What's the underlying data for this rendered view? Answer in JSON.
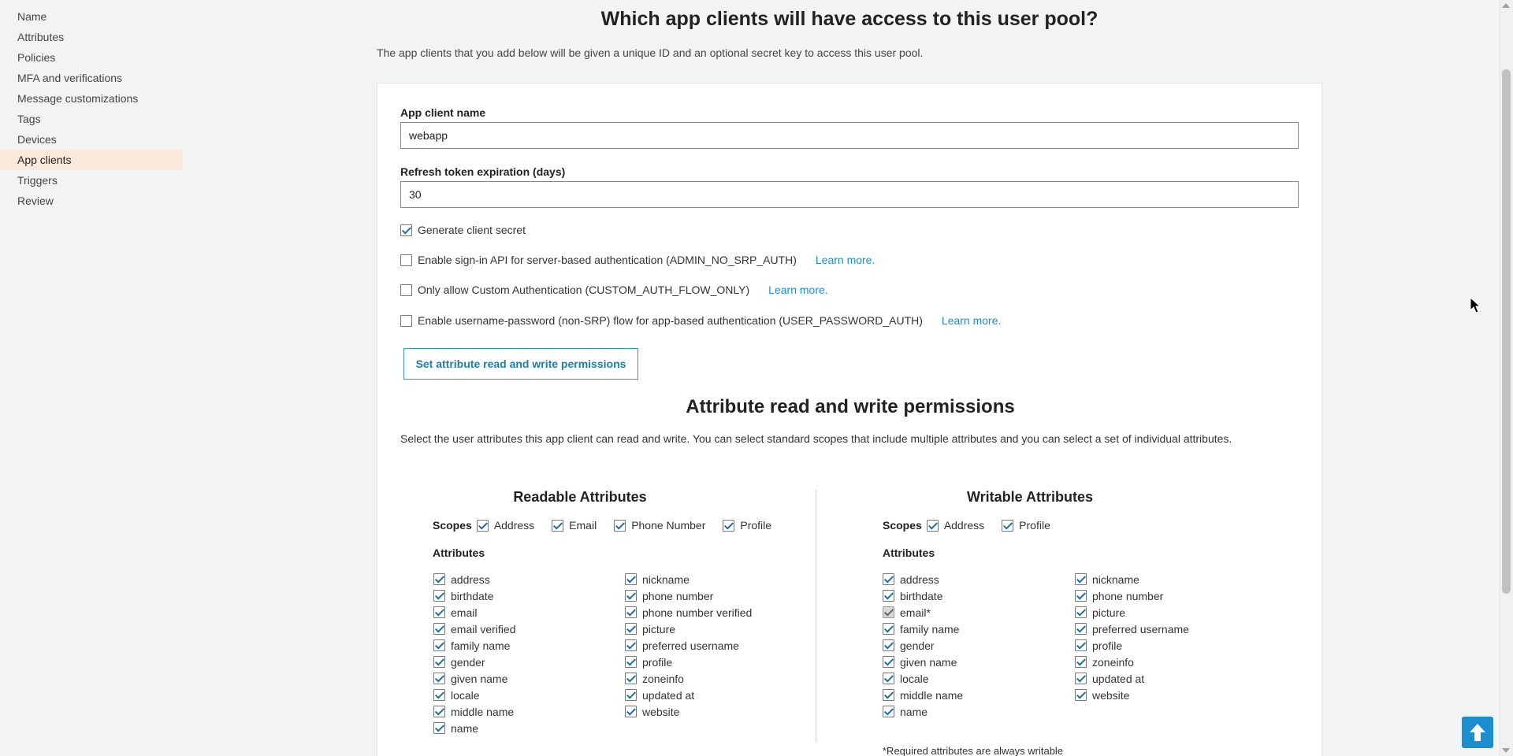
{
  "sidebar": {
    "items": [
      {
        "label": "Name"
      },
      {
        "label": "Attributes"
      },
      {
        "label": "Policies"
      },
      {
        "label": "MFA and verifications"
      },
      {
        "label": "Message customizations"
      },
      {
        "label": "Tags"
      },
      {
        "label": "Devices"
      },
      {
        "label": "App clients",
        "active": true
      },
      {
        "label": "Triggers"
      },
      {
        "label": "Review"
      }
    ]
  },
  "header": {
    "title": "Which app clients will have access to this user pool?",
    "subtitle": "The app clients that you add below will be given a unique ID and an optional secret key to access this user pool."
  },
  "form": {
    "client_name_label": "App client name",
    "client_name_value": "webapp",
    "refresh_label": "Refresh token expiration (days)",
    "refresh_value": "30",
    "options": [
      {
        "label": "Generate client secret",
        "checked": true,
        "link": ""
      },
      {
        "label": "Enable sign-in API for server-based authentication (ADMIN_NO_SRP_AUTH)",
        "checked": false,
        "link": "Learn more."
      },
      {
        "label": "Only allow Custom Authentication (CUSTOM_AUTH_FLOW_ONLY)",
        "checked": false,
        "link": "Learn more."
      },
      {
        "label": "Enable username-password (non-SRP) flow for app-based authentication (USER_PASSWORD_AUTH)",
        "checked": false,
        "link": "Learn more."
      }
    ],
    "permissions_button": "Set attribute read and write permissions"
  },
  "permissions": {
    "title": "Attribute read and write permissions",
    "description": "Select the user attributes this app client can read and write. You can select standard scopes that include multiple attributes and you can select a set of individual attributes.",
    "scopes_label": "Scopes",
    "attributes_label": "Attributes",
    "readable": {
      "title": "Readable Attributes",
      "scopes": [
        "Address",
        "Email",
        "Phone Number",
        "Profile"
      ],
      "col1": [
        "address",
        "birthdate",
        "email",
        "email verified",
        "family name",
        "gender",
        "given name",
        "locale",
        "middle name",
        "name"
      ],
      "col2": [
        "nickname",
        "phone number",
        "phone number verified",
        "picture",
        "preferred username",
        "profile",
        "zoneinfo",
        "updated at",
        "website"
      ]
    },
    "writable": {
      "title": "Writable Attributes",
      "scopes": [
        "Address",
        "Profile"
      ],
      "col1": [
        "address",
        "birthdate",
        "email*",
        "family name",
        "gender",
        "given name",
        "locale",
        "middle name",
        "name"
      ],
      "col2": [
        "nickname",
        "phone number",
        "picture",
        "preferred username",
        "profile",
        "zoneinfo",
        "updated at",
        "website"
      ],
      "disabled": [
        "email*"
      ]
    },
    "required_note": "*Required attributes are always writable"
  },
  "colors": {
    "accent": "#1a8ecf",
    "active_sidebar": "#fbe9db",
    "checkmark": "#1b6fa8"
  },
  "icons": {
    "back_to_top": "arrow-up-icon",
    "cursor": "mouse-cursor-icon"
  }
}
